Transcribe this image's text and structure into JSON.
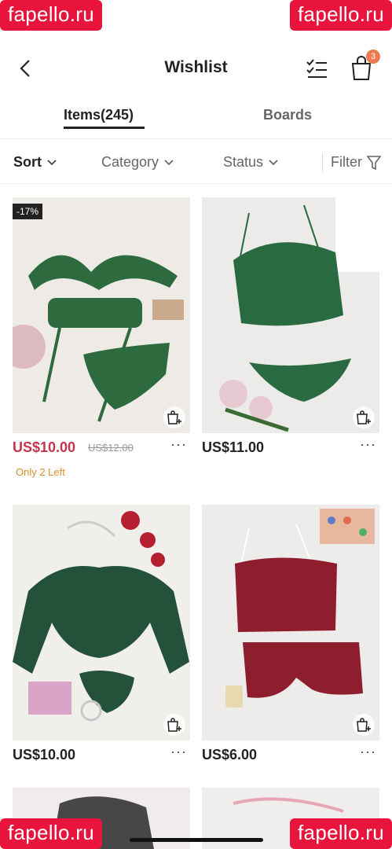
{
  "watermark": {
    "text": "fapello.ru"
  },
  "header": {
    "title": "Wishlist",
    "cart_count": "3"
  },
  "tabs": {
    "items": "Items(245)",
    "boards": "Boards"
  },
  "filters": {
    "sort": "Sort",
    "category": "Category",
    "status": "Status",
    "filter": "Filter"
  },
  "products": [
    {
      "price": "US$10.00",
      "original_price": "US$12.00",
      "discount": "-17%",
      "stock_note": "Only 2 Left",
      "more": "···",
      "colors": {
        "garment": "#2d6b3f",
        "bg": "#eeeae6"
      }
    },
    {
      "price": "US$11.00",
      "more": "···",
      "colors": {
        "garment": "#2a6a40",
        "bg": "#ecebea"
      }
    },
    {
      "price": "US$10.00",
      "more": "···",
      "colors": {
        "garment": "#24513a",
        "bg": "#f1efec"
      }
    },
    {
      "price": "US$6.00",
      "more": "···",
      "colors": {
        "garment": "#8e1d2e",
        "bg": "#eeeceb"
      }
    }
  ],
  "colors": {
    "sale": "#c4344a",
    "stock": "#d4902c",
    "badge": "#ec7b4f",
    "watermark": "#e8143c"
  }
}
